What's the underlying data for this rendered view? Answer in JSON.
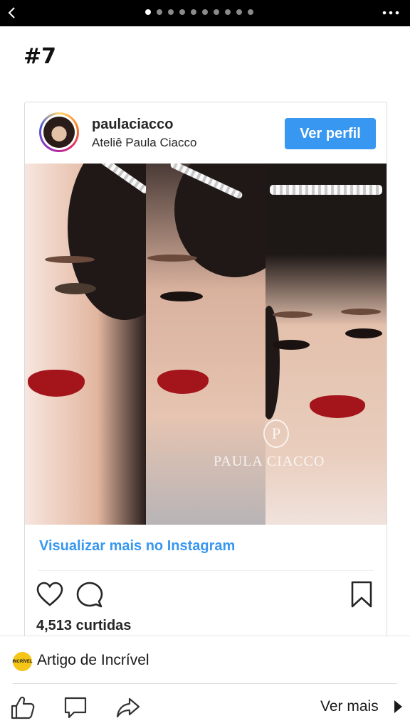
{
  "topbar": {
    "slide_count": 10,
    "active_slide": 1
  },
  "article": {
    "heading": "#7"
  },
  "post": {
    "username": "paulaciacco",
    "display_name": "Ateliê Paula Ciacco",
    "view_profile_label": "Ver perfil",
    "watermark_initial": "P",
    "watermark": "PAULA CIACCO",
    "view_more_link": "Visualizar mais no Instagram",
    "likes": "4,513 curtidas"
  },
  "source": {
    "logo_text": "INCRÍVEL",
    "name": "Artigo de Incrível",
    "ver_mais_label": "Ver mais"
  },
  "colors": {
    "accent": "#3897f0",
    "topbar": "#000000",
    "lips": "#a4141b"
  }
}
